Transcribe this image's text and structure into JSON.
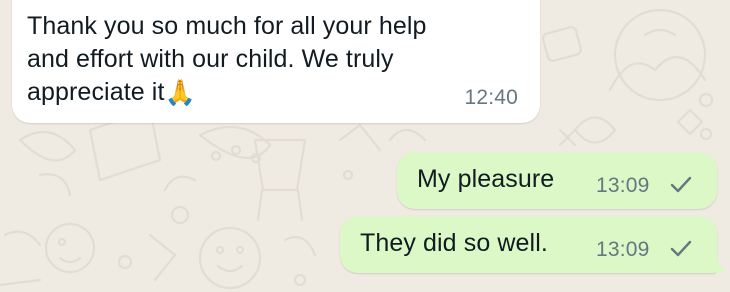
{
  "theme": {
    "chat_background": "#efeae2",
    "incoming_bubble": "#ffffff",
    "outgoing_bubble": "#dcf8c6",
    "text": "#111b21",
    "timestamp": "#667781"
  },
  "messages": [
    {
      "direction": "incoming",
      "lines": [
        "Thank you so much for all your help",
        "and effort with our child. We truly",
        "appreciate it"
      ],
      "emoji": "🙏",
      "emoji_name": "folded-hands-emoji",
      "time": "12:40"
    },
    {
      "direction": "outgoing",
      "text": "My pleasure",
      "time": "13:09",
      "status_icon": "single-check-icon"
    },
    {
      "direction": "outgoing",
      "text": "They did so well.",
      "time": "13:09",
      "status_icon": "single-check-icon"
    }
  ]
}
